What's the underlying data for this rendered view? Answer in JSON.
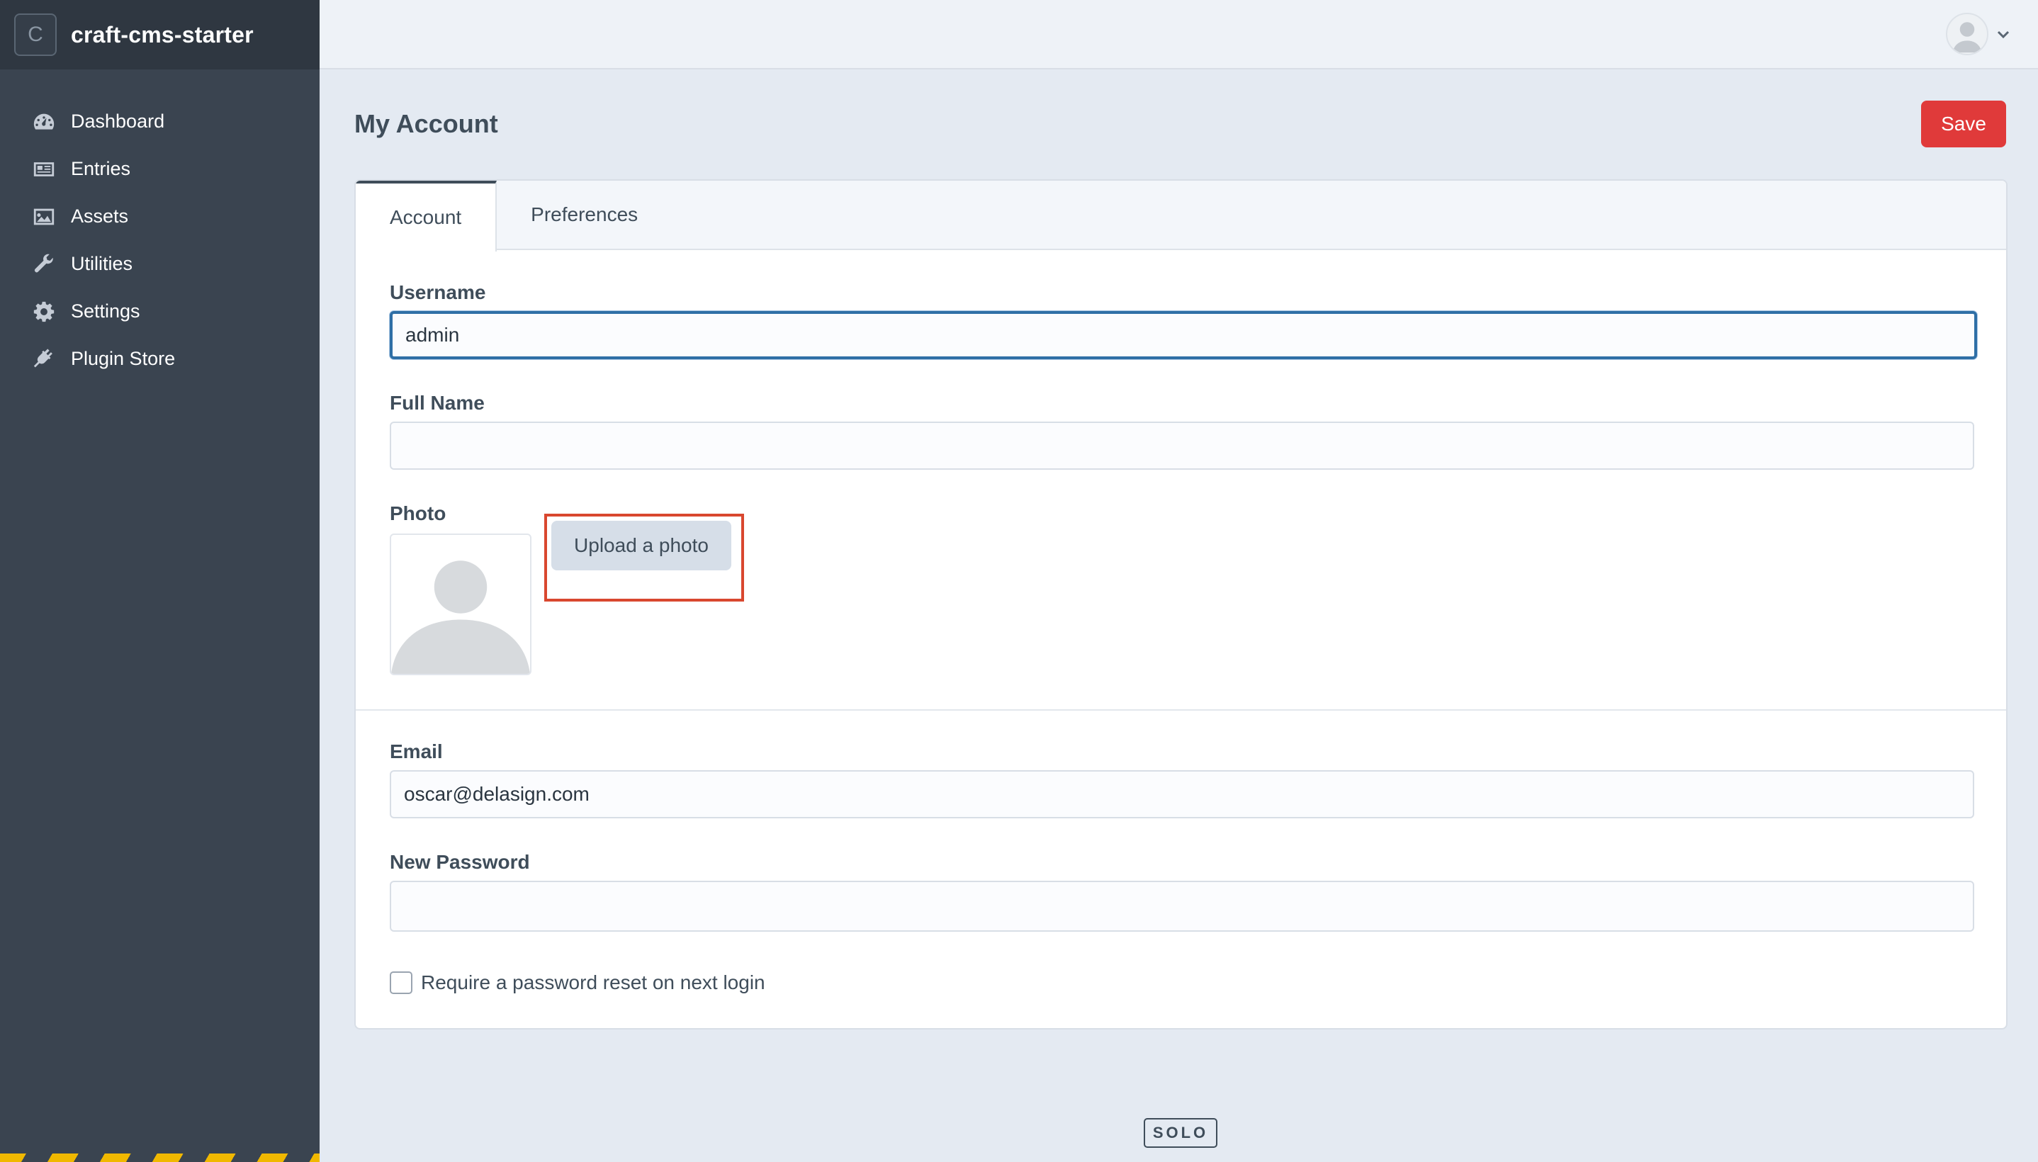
{
  "site": {
    "badge": "C",
    "name": "craft-cms-starter"
  },
  "sidebar": {
    "items": [
      {
        "label": "Dashboard",
        "icon": "gauge-icon"
      },
      {
        "label": "Entries",
        "icon": "newspaper-icon"
      },
      {
        "label": "Assets",
        "icon": "image-icon"
      },
      {
        "label": "Utilities",
        "icon": "wrench-icon"
      },
      {
        "label": "Settings",
        "icon": "gear-icon"
      },
      {
        "label": "Plugin Store",
        "icon": "plug-icon"
      }
    ]
  },
  "header": {
    "user_menu_icon": "user-avatar-icon"
  },
  "page": {
    "title": "My Account",
    "save_label": "Save"
  },
  "tabs": [
    {
      "label": "Account",
      "active": true
    },
    {
      "label": "Preferences",
      "active": false
    }
  ],
  "form": {
    "username": {
      "label": "Username",
      "value": "admin"
    },
    "full_name": {
      "label": "Full Name",
      "value": ""
    },
    "photo": {
      "label": "Photo",
      "upload_label": "Upload a photo"
    },
    "email": {
      "label": "Email",
      "value": "oscar@delasign.com"
    },
    "new_password": {
      "label": "New Password",
      "value": ""
    },
    "require_reset": {
      "label": "Require a password reset on next login",
      "checked": false
    }
  },
  "footer": {
    "edition": "SOLO"
  },
  "colors": {
    "sidebar": "#3a4450",
    "save": "#e03a3a",
    "highlight": "#d9472f",
    "focus": "#2f6fa6"
  }
}
